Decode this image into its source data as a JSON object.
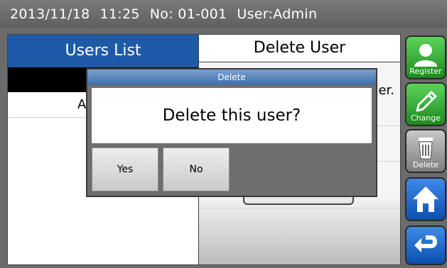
{
  "status_bar": {
    "date": "2013/11/18",
    "time": "11:25",
    "number": "No: 01-001",
    "user": "User:Admin"
  },
  "users_panel": {
    "title": "Users List",
    "selected_row": "",
    "rows": [
      "A"
    ]
  },
  "detail_panel": {
    "title": "Delete User",
    "text_fragment": "er."
  },
  "sidebar": {
    "register_label": "Register",
    "change_label": "Change",
    "delete_label": "Delete",
    "home_icon": "home-icon",
    "back_icon": "back-arrow-icon"
  },
  "dialog": {
    "title": "Delete",
    "message": "Delete this user?",
    "yes_label": "Yes",
    "no_label": "No"
  },
  "colors": {
    "header_blue": "#1e5aa8",
    "sidebar_green": "#2aa82a",
    "sidebar_blue": "#0d4fb0",
    "dialog_title": "#3f6ea8"
  }
}
